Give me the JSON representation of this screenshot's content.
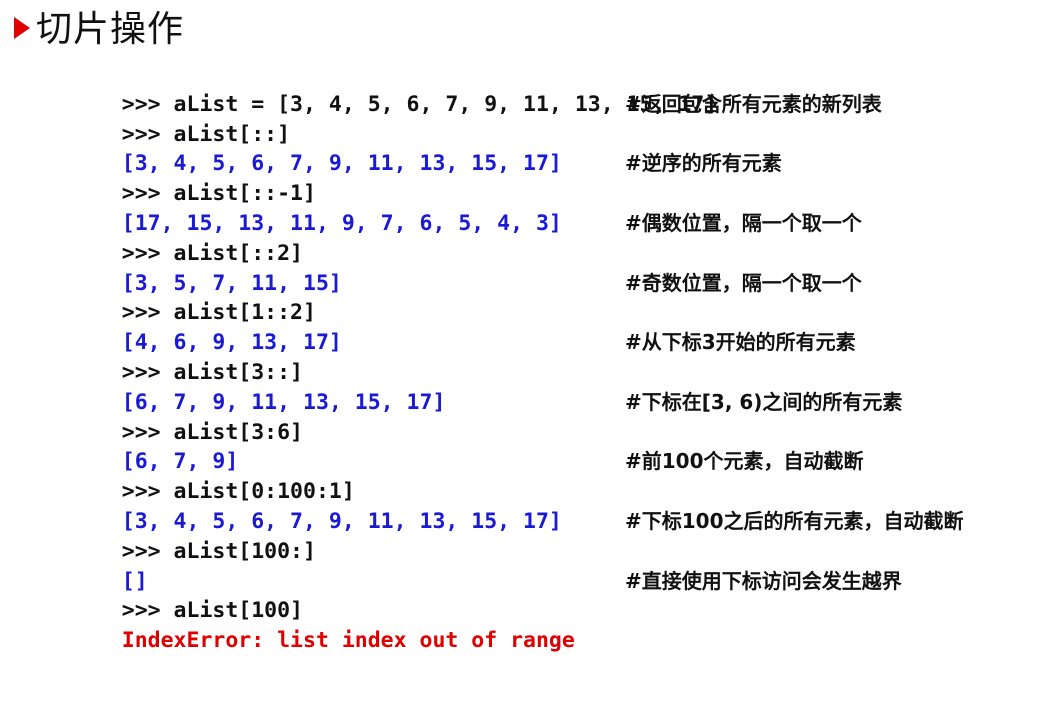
{
  "slide": {
    "title": "切片操作"
  },
  "lines": [
    {
      "kind": "cmd",
      "code": ">>> aList = [3, 4, 5, 6, 7, 9, 11, 13, 15, 17]",
      "comment": ""
    },
    {
      "kind": "cmd",
      "code": ">>> aList[::]",
      "comment": "#返回包含所有元素的新列表"
    },
    {
      "kind": "out",
      "code": "[3, 4, 5, 6, 7, 9, 11, 13, 15, 17]",
      "comment": ""
    },
    {
      "kind": "cmd",
      "code": ">>> aList[::-1]",
      "comment": "#逆序的所有元素"
    },
    {
      "kind": "out",
      "code": "[17, 15, 13, 11, 9, 7, 6, 5, 4, 3]",
      "comment": ""
    },
    {
      "kind": "cmd",
      "code": ">>> aList[::2]",
      "comment": "#偶数位置，隔一个取一个"
    },
    {
      "kind": "out",
      "code": "[3, 5, 7, 11, 15]",
      "comment": ""
    },
    {
      "kind": "cmd",
      "code": ">>> aList[1::2]",
      "comment": "#奇数位置，隔一个取一个"
    },
    {
      "kind": "out",
      "code": "[4, 6, 9, 13, 17]",
      "comment": ""
    },
    {
      "kind": "cmd",
      "code": ">>> aList[3::]",
      "comment": "#从下标3开始的所有元素"
    },
    {
      "kind": "out",
      "code": "[6, 7, 9, 11, 13, 15, 17]",
      "comment": ""
    },
    {
      "kind": "cmd",
      "code": ">>> aList[3:6]",
      "comment": "#下标在[3, 6)之间的所有元素"
    },
    {
      "kind": "out",
      "code": "[6, 7, 9]",
      "comment": ""
    },
    {
      "kind": "cmd",
      "code": ">>> aList[0:100:1]",
      "comment": "#前100个元素，自动截断"
    },
    {
      "kind": "out",
      "code": "[3, 4, 5, 6, 7, 9, 11, 13, 15, 17]",
      "comment": ""
    },
    {
      "kind": "cmd",
      "code": ">>> aList[100:]",
      "comment": "#下标100之后的所有元素，自动截断"
    },
    {
      "kind": "out",
      "code": "[]",
      "comment": ""
    },
    {
      "kind": "cmd",
      "code": ">>> aList[100]",
      "comment": "#直接使用下标访问会发生越界"
    },
    {
      "kind": "err",
      "code": "IndexError: list index out of range",
      "comment": ""
    }
  ],
  "colors": {
    "command": "#111111",
    "output": "#1a1ad6",
    "error": "#e00000",
    "bullet": "#e00000"
  }
}
